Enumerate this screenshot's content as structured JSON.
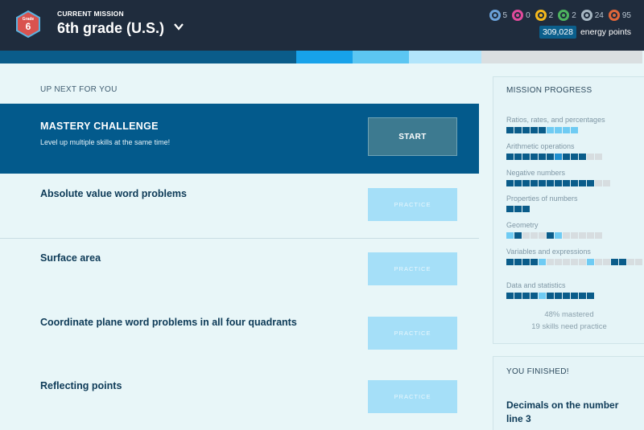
{
  "header": {
    "badge_small": "Grade",
    "badge_num": "6",
    "mission_label": "CURRENT MISSION",
    "mission_title": "6th grade (U.S.)",
    "stats": [
      {
        "icon": "blue-badge-icon",
        "value": "5",
        "color": "#6aa0d8"
      },
      {
        "icon": "pink-badge-icon",
        "value": "0",
        "color": "#e04a9b"
      },
      {
        "icon": "gold-badge-icon",
        "value": "2",
        "color": "#f4b81c"
      },
      {
        "icon": "green-badge-icon",
        "value": "2",
        "color": "#4db35e"
      },
      {
        "icon": "silver-badge-icon",
        "value": "24",
        "color": "#a6b6c2"
      },
      {
        "icon": "orange-badge-icon",
        "value": "95",
        "color": "#e0663a"
      }
    ],
    "energy_value": "309,028",
    "energy_label": "energy points"
  },
  "progress_strip": [
    {
      "color": "#0a5c8a",
      "fraction": 0.46
    },
    {
      "color": "#17a2ea",
      "fraction": 0.0875
    },
    {
      "color": "#5cc6f2",
      "fraction": 0.0875
    },
    {
      "color": "#b2e5fb",
      "fraction": 0.1125
    },
    {
      "color": "#dadfe1",
      "fraction": 0.25
    }
  ],
  "main": {
    "upnext_label": "UP NEXT FOR YOU",
    "mastery": {
      "title": "MASTERY CHALLENGE",
      "subtitle": "Level up multiple skills at the same time!",
      "button": "START"
    },
    "skills": [
      {
        "title": "Absolute value word problems",
        "button": "PRACTICE"
      },
      {
        "title": "Surface area",
        "button": "PRACTICE"
      },
      {
        "title": "Coordinate plane word problems in all four quadrants",
        "button": "PRACTICE"
      },
      {
        "title": "Reflecting points",
        "button": "PRACTICE"
      }
    ]
  },
  "mission_progress": {
    "heading": "MISSION PROGRESS",
    "colors": {
      "M": "#0a5c8a",
      "P": "#1e8fd0",
      "L": "#6fcbf3",
      "N": "#d7dde0"
    },
    "categories": [
      {
        "label": "Ratios, rates, and percentages",
        "cells": "MMMMMLLLL"
      },
      {
        "label": "Arithmetic operations",
        "cells": "MMMMMMPMMMNN"
      },
      {
        "label": "Negative numbers",
        "cells": "MMMMMMMMMMMNN"
      },
      {
        "label": "Properties of numbers",
        "cells": "MMM"
      },
      {
        "label": "Geometry",
        "cells": "LMNNNMLNNNNN"
      },
      {
        "label": "Variables and expressions",
        "cells": "MMMMLNNNNNLNNMMNN"
      },
      {
        "label": "Data and statistics",
        "cells": "MMMMLMMMMMM"
      }
    ],
    "mastered": "48% mastered",
    "need_practice": "19 skills need practice"
  },
  "finished": {
    "heading": "YOU FINISHED!",
    "skill": "Decimals on the number line 3"
  }
}
